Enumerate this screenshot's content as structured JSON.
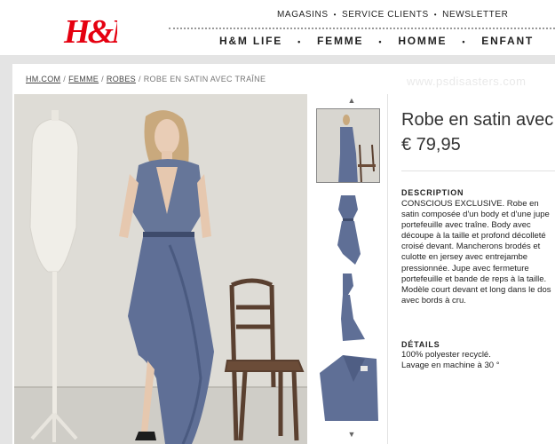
{
  "brand": {
    "logo_text": "H&M",
    "color": "#e50010"
  },
  "header": {
    "util_nav": [
      "MAGASINS",
      "SERVICE CLIENTS",
      "NEWSLETTER"
    ],
    "main_nav": [
      "H&M LIFE",
      "FEMME",
      "HOMME",
      "ENFANT"
    ]
  },
  "breadcrumb": {
    "items": [
      "HM.COM",
      "FEMME",
      "ROBES"
    ],
    "current": "ROBE EN SATIN AVEC TRAÎNE"
  },
  "watermark": "www.psdisasters.com",
  "product": {
    "title": "Robe en satin avec traîne",
    "price": "€ 79,95",
    "description_heading": "DESCRIPTION",
    "description": "CONSCIOUS EXCLUSIVE. Robe en satin composée d'un body et d'une jupe portefeuille avec traîne. Body avec découpe à la taille et profond décolleté croisé devant. Mancherons brodés et culotte en jersey avec entrejambe pressionnée. Jupe avec fermeture portefeuille et bande de reps à la taille. Modèle court devant et long dans le dos avec bords à cru.",
    "details_heading": "DÉTAILS",
    "details": [
      "100% polyester recyclé.",
      "Lavage en machine à 30 °"
    ]
  },
  "gallery": {
    "up_arrow": "▲",
    "down_arrow": "▼",
    "thumbs": [
      "model-full",
      "dress-front",
      "dress-side",
      "dress-closeup"
    ]
  },
  "colors": {
    "dress": "#5f6f96",
    "wall": "#d8d6d0"
  }
}
